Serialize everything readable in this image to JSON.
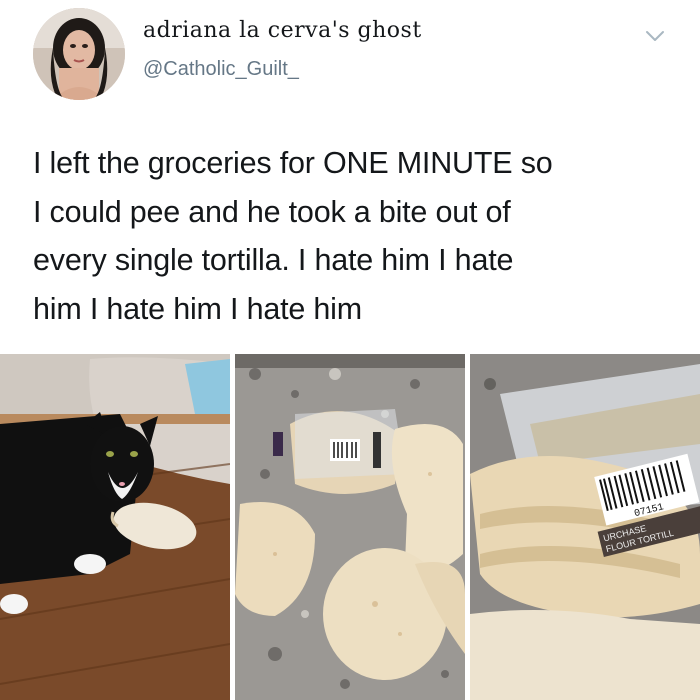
{
  "user": {
    "display_name": "adriana la cerva's ghost",
    "handle": "@Catholic_Guilt_",
    "avatar_icon": "profile-photo"
  },
  "menu": {
    "icon": "chevron-down-icon"
  },
  "tweet": {
    "lines": [
      "I left the groceries for ONE MINUTE so",
      "I could pee and he took a bite out of",
      "every single tortilla. I hate him I hate",
      "him I hate him I hate him"
    ]
  },
  "photos": {
    "photo_3_barcode_digits": "07151",
    "photo_3_label_1": "URCHASE",
    "photo_3_label_2": "FLOUR TORTILL"
  },
  "colors": {
    "text": "#14171a",
    "secondary": "#657786"
  }
}
